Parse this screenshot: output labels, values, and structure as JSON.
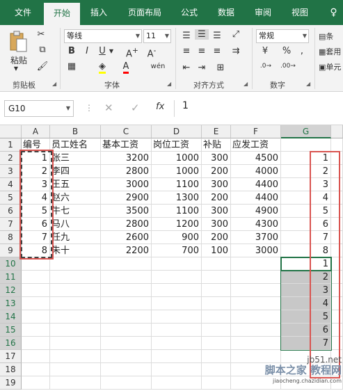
{
  "tabs": [
    "文件",
    "开始",
    "插入",
    "页面布局",
    "公式",
    "数据",
    "审阅",
    "视图"
  ],
  "ribbon": {
    "paste_label": "粘贴",
    "font_name": "等线",
    "font_size": "11",
    "number_format": "常规",
    "groups": {
      "clipboard": "剪贴板",
      "font": "字体",
      "alignment": "对齐方式",
      "number": "数字"
    },
    "right_cut": [
      "条",
      "套用",
      "单元"
    ],
    "wen_label": "wén",
    "bold": "B",
    "italic": "I",
    "underline": "U",
    "percent": "%",
    "comma": ","
  },
  "formula_bar": {
    "name_box": "G10",
    "value": "1",
    "fx": "fx"
  },
  "sheet": {
    "columns": [
      "A",
      "B",
      "C",
      "D",
      "E",
      "F",
      "G"
    ],
    "rows": [
      "1",
      "2",
      "3",
      "4",
      "5",
      "6",
      "7",
      "8",
      "9",
      "10",
      "11",
      "12",
      "13",
      "14",
      "15",
      "16",
      "17",
      "18",
      "19"
    ],
    "header_row": [
      "编号",
      "员工姓名",
      "基本工资",
      "岗位工资",
      "补贴",
      "应发工资"
    ],
    "data": [
      [
        "1",
        "张三",
        "3200",
        "1000",
        "300",
        "4500"
      ],
      [
        "2",
        "李四",
        "2800",
        "1000",
        "200",
        "4000"
      ],
      [
        "3",
        "王五",
        "3000",
        "1100",
        "300",
        "4400"
      ],
      [
        "4",
        "赵六",
        "2900",
        "1300",
        "200",
        "4400"
      ],
      [
        "5",
        "牛七",
        "3500",
        "1100",
        "300",
        "4900"
      ],
      [
        "6",
        "马八",
        "2800",
        "1200",
        "300",
        "4300"
      ],
      [
        "7",
        "任九",
        "2600",
        "900",
        "200",
        "3700"
      ],
      [
        "8",
        "朱十",
        "2200",
        "700",
        "100",
        "3000"
      ]
    ],
    "g_col_top": [
      "1",
      "2",
      "3",
      "4",
      "5",
      "6",
      "7",
      "8"
    ],
    "g_col_bottom": [
      "1",
      "2",
      "3",
      "4",
      "5",
      "6",
      "7"
    ]
  },
  "watermark": {
    "site": "jb51.net",
    "text": "脚本之家 教程网",
    "sub": "jiaocheng.chazidian.com"
  },
  "colors": {
    "excel_green": "#217346",
    "highlight_red": "#d9534f",
    "selection_gray": "#c8c8c8"
  }
}
